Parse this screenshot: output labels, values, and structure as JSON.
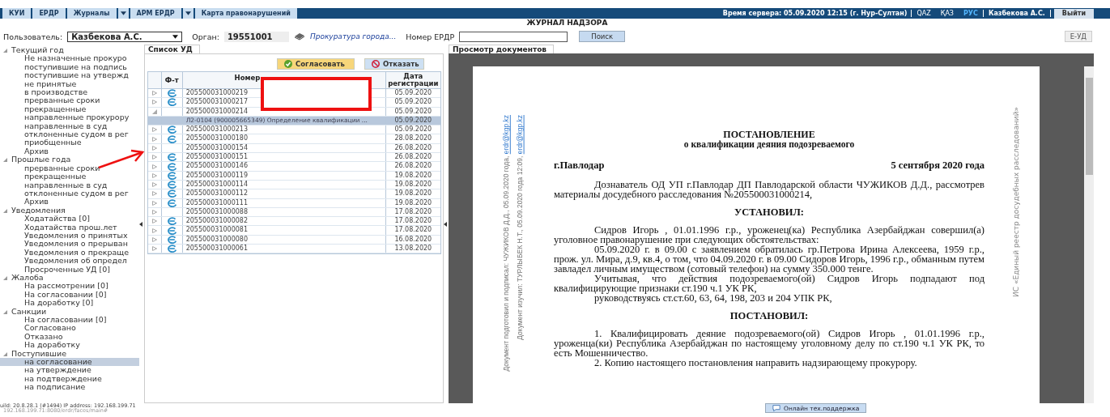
{
  "top_menu": [
    {
      "label": "КУИ",
      "dropdown": false
    },
    {
      "label": "ЕРДР",
      "dropdown": false
    },
    {
      "label": "Журналы",
      "dropdown": true
    },
    {
      "label": "АРМ ЕРДР",
      "dropdown": true
    },
    {
      "label": "Карта правонарушений",
      "dropdown": false
    }
  ],
  "server_time": "Время сервера: 05.09.2020 12:15 (г. Нур-Султан)",
  "languages": [
    {
      "label": "QAZ",
      "selected": false
    },
    {
      "label": "ҚАЗ",
      "selected": false
    },
    {
      "label": "РУС",
      "selected": true
    }
  ],
  "current_user": "Казбекова А.С.",
  "logout_button": "Выйти",
  "page_title": "ЖУРНАЛ НАДЗОРА",
  "filters": {
    "user_label": "Пользователь:",
    "user_value": "Казбекова А.С.",
    "organ_label": "Орган:",
    "organ_value": "19551001",
    "organ_link": "Прокуратура города...",
    "erdr_label": "Номер ЕРДР",
    "search_button": "Поиск",
    "eud_button": "Е-УД"
  },
  "tree": [
    {
      "label": "Текущий год",
      "expanded": true,
      "children": [
        {
          "label": "Не назначенные прокуро",
          "selected": false
        },
        {
          "label": "поступившие на подпись",
          "selected": false
        },
        {
          "label": "поступившие на утвержд",
          "selected": false
        },
        {
          "label": "не принятые",
          "selected": false
        },
        {
          "label": "в производстве",
          "selected": false
        },
        {
          "label": "прерванные сроки",
          "selected": false
        },
        {
          "label": "прекращенные",
          "selected": false
        },
        {
          "label": "направленные прокурору",
          "selected": false
        },
        {
          "label": "направленные в суд",
          "selected": false
        },
        {
          "label": "отклоненные судом в рег",
          "selected": false
        },
        {
          "label": "приобщенные",
          "selected": false
        },
        {
          "label": "Архив",
          "selected": false
        }
      ]
    },
    {
      "label": "Прошлые года",
      "expanded": true,
      "children": [
        {
          "label": "прерванные сроки",
          "selected": false
        },
        {
          "label": "прекращенные",
          "selected": false
        },
        {
          "label": "направленные в суд",
          "selected": false
        },
        {
          "label": "отклоненные судом в рег",
          "selected": false
        },
        {
          "label": "Архив",
          "selected": false
        }
      ]
    },
    {
      "label": "Уведомления",
      "expanded": true,
      "children": [
        {
          "label": "Ходатайства [0]",
          "selected": false
        },
        {
          "label": "Ходатайства прош.лет",
          "selected": false
        },
        {
          "label": "Уведомления о принятых",
          "selected": false
        },
        {
          "label": "Уведомления о прерыван",
          "selected": false
        },
        {
          "label": "Уведомления о прекраще",
          "selected": false
        },
        {
          "label": "Уведомления об определ",
          "selected": false
        },
        {
          "label": "Просроченные УД [0]",
          "selected": false
        }
      ]
    },
    {
      "label": "Жалоба",
      "expanded": true,
      "children": [
        {
          "label": "На рассмотрении [0]",
          "selected": false
        },
        {
          "label": "На согласовании [0]",
          "selected": false
        },
        {
          "label": "На доработку [0]",
          "selected": false
        }
      ]
    },
    {
      "label": "Санкции",
      "expanded": true,
      "children": [
        {
          "label": "На согласовании [0]",
          "selected": false
        },
        {
          "label": "Согласовано",
          "selected": false
        },
        {
          "label": "Отказано",
          "selected": false
        },
        {
          "label": "На доработку",
          "selected": false
        }
      ]
    },
    {
      "label": "Поступившие",
      "expanded": true,
      "children": [
        {
          "label": "на согласование",
          "selected": true
        },
        {
          "label": "на утверждение",
          "selected": false
        },
        {
          "label": "на подтверждение",
          "selected": false
        },
        {
          "label": "на подписание",
          "selected": false
        }
      ]
    }
  ],
  "case_list": {
    "tab": "Список УД",
    "approve_button": "Согласовать",
    "reject_button": "Отказать",
    "columns": [
      "Ф-т",
      "Номер",
      "Дата регистрации"
    ],
    "rows": [
      {
        "number": "205500031000219",
        "date": "05.09.2020",
        "format_icon": true,
        "expanded": false
      },
      {
        "number": "205500031000217",
        "date": "05.09.2020",
        "format_icon": true,
        "expanded": false
      },
      {
        "number": "205500031000214",
        "date": "05.09.2020",
        "format_icon": false,
        "expanded": true,
        "children": [
          {
            "number": "Л2-0104 (900005665349) Определение квалификации ...",
            "date": "05.09.2020",
            "selected": true
          }
        ]
      },
      {
        "number": "205500031000213",
        "date": "05.09.2020",
        "format_icon": true,
        "expanded": false
      },
      {
        "number": "205500031000180",
        "date": "28.08.2020",
        "format_icon": true,
        "expanded": false
      },
      {
        "number": "205500031000154",
        "date": "26.08.2020",
        "format_icon": false,
        "expanded": false
      },
      {
        "number": "205500031000151",
        "date": "26.08.2020",
        "format_icon": true,
        "expanded": false
      },
      {
        "number": "205500031000146",
        "date": "26.08.2020",
        "format_icon": true,
        "expanded": false
      },
      {
        "number": "205500031000119",
        "date": "19.08.2020",
        "format_icon": true,
        "expanded": false
      },
      {
        "number": "205500031000114",
        "date": "19.08.2020",
        "format_icon": true,
        "expanded": false
      },
      {
        "number": "205500031000112",
        "date": "19.08.2020",
        "format_icon": true,
        "expanded": false
      },
      {
        "number": "205500031000111",
        "date": "19.08.2020",
        "format_icon": true,
        "expanded": false
      },
      {
        "number": "205500031000088",
        "date": "17.08.2020",
        "format_icon": false,
        "expanded": false
      },
      {
        "number": "205500031000082",
        "date": "17.08.2020",
        "format_icon": true,
        "expanded": false
      },
      {
        "number": "205500031000081",
        "date": "17.08.2020",
        "format_icon": true,
        "expanded": false
      },
      {
        "number": "205500031000080",
        "date": "16.08.2020",
        "format_icon": true,
        "expanded": false
      },
      {
        "number": "205500031000061",
        "date": "13.08.2020",
        "format_icon": true,
        "expanded": false
      }
    ]
  },
  "document_viewer": {
    "tab": "Просмотр документов",
    "stamp_lines": [
      {
        "text": "Документ подготовил и подписал: ЧУЖИКОВ Д.Д., 05.09.2020 года,",
        "email": "erdr@kgp.kz"
      },
      {
        "text": "Документ изучил: ТУРЛЫБЕК Н.Т., 05.09.2020 года 12:09,",
        "email": "erdr@kgp.kz"
      }
    ],
    "side_note": "ИС «Единый реестр досудебных расследований»",
    "title": "ПОСТАНОВЛЕНИЕ",
    "subtitle": "о квалификации деяния подозреваемого",
    "city": "г.Павлодар",
    "date": "5 сентября 2020 года",
    "blocks": [
      {
        "kind": "para",
        "text": "Дознаватель ОД УП г.Павлодар ДП Павлодарской области ЧУЖИКОВ Д.Д., рассмотрев материалы досудебного расследования №205500031000214,"
      },
      {
        "kind": "heading",
        "text": "УСТАНОВИЛ:"
      },
      {
        "kind": "para",
        "text": "Сидров Игорь , 01.01.1996 г.р., уроженец(ка)    Республика Азербайджан совершил(а) уголовное правонарушение при следующих обстоятельствах:"
      },
      {
        "kind": "para",
        "text": "05.09.2020 г. в 09.00 с заявлением обратилась гр.Петрова Ирина Алексеева, 1959 г.р., прож. ул. Мира, д.9, кв.4, о том, что 04.09.2020 г. в 09.00 Сидоров Игорь, 1996 г.р., обманным путем завладел личным имуществом (сотовый телефон) на сумму 350.000 тенге."
      },
      {
        "kind": "para",
        "text": "Учитывая, что действия подозреваемого(ой) Сидров Игорь  подпадают под квалифицирующие признаки ст.190 ч.1 УК РК,"
      },
      {
        "kind": "para",
        "text": "руководствуясь ст.ст.60, 63, 64, 198, 203 и 204 УПК РК,"
      },
      {
        "kind": "heading",
        "text": "ПОСТАНОВИЛ:"
      },
      {
        "kind": "para",
        "text": "1. Квалифицировать деяние подозреваемого(ой) Сидров Игорь , 01.01.1996 г.р., уроженца(ки)    Республика Азербайджан по настоящему уголовному делу по ст.190 ч.1 УК РК, то есть Мошенничество."
      },
      {
        "kind": "para",
        "text": "2. Копию настоящего постановления направить надзирающему прокурору."
      }
    ]
  },
  "status": {
    "build": "uild: 20.8.28.1 (#1494)   IP address: 192.168.199.71",
    "url": "192.168.199.71:8080/erdr/faces/main#",
    "support_button": "Онлайн тех.поддержка"
  }
}
